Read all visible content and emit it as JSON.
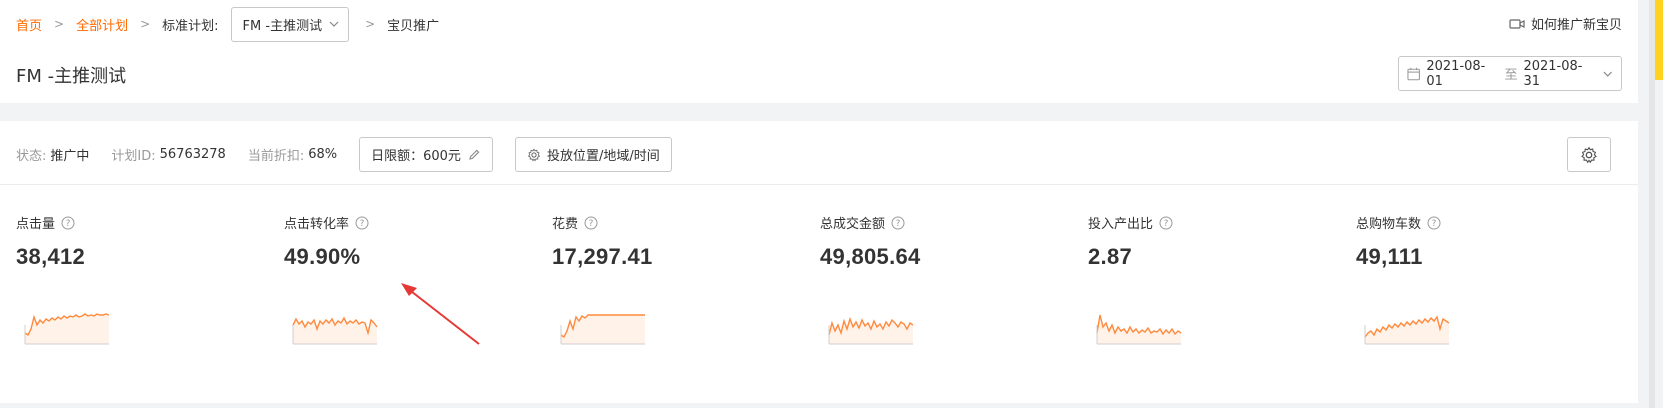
{
  "breadcrumb": {
    "home": "首页",
    "all_plans": "全部计划",
    "standard_plan_label": "标准计划:",
    "selected_plan": "FM -主推测试",
    "current": "宝贝推广"
  },
  "help_link": "如何推广新宝贝",
  "page_title": "FM -主推测试",
  "date_range": {
    "start": "2021-08-01",
    "separator": "至",
    "end": "2021-08-31"
  },
  "info": {
    "status_label": "状态:",
    "status_value": "推广中",
    "plan_id_label": "计划ID:",
    "plan_id_value": "56763278",
    "discount_label": "当前折扣:",
    "discount_value": "68%",
    "budget_label": "日限额：600元",
    "placement_label": "投放位置/地域/时间"
  },
  "metrics": [
    {
      "label": "点击量",
      "value": "38,412"
    },
    {
      "label": "点击转化率",
      "value": "49.90%"
    },
    {
      "label": "花费",
      "value": "17,297.41"
    },
    {
      "label": "总成交金额",
      "value": "49,805.64"
    },
    {
      "label": "投入产出比",
      "value": "2.87"
    },
    {
      "label": "总购物车数",
      "value": "49,111"
    }
  ],
  "colors": {
    "accent": "#ff6a00",
    "spark": "#ff8a3d",
    "arrow": "#e53935"
  }
}
